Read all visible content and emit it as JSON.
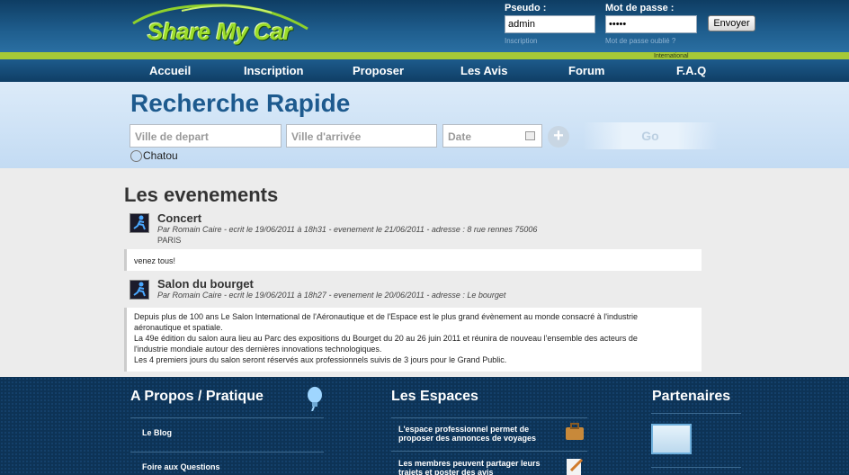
{
  "header": {
    "logo_text": "Share My Car",
    "pseudo_label": "Pseudo :",
    "pseudo_value": "admin",
    "password_label": "Mot de passe :",
    "password_value": "•••••",
    "send_label": "Envoyer",
    "register_link": "Inscription",
    "forgot_link": "Mot de passe oublié ?",
    "international": "International"
  },
  "nav": [
    "Accueil",
    "Inscription",
    "Proposer",
    "Les Avis",
    "Forum",
    "F.A.Q"
  ],
  "search": {
    "title": "Recherche Rapide",
    "from_placeholder": "Ville de depart",
    "to_placeholder": "Ville d'arrivée",
    "date_placeholder": "Date",
    "go_label": "Go",
    "city": "Chatou"
  },
  "events": {
    "title": "Les evenements",
    "items": [
      {
        "title": "Concert",
        "meta": "Par Romain Caire - ecrit le 19/06/2011 à 18h31 - evenement le 21/06/2011 - adresse : 8 rue rennes 75006",
        "meta2": "PARIS",
        "body": [
          "venez tous!"
        ]
      },
      {
        "title": "Salon du bourget",
        "meta": "Par Romain Caire - ecrit le 19/06/2011 à 18h27 - evenement le 20/06/2011 - adresse : Le bourget",
        "meta2": "",
        "body": [
          "Depuis plus de 100 ans Le Salon International de l'Aéronautique et de l'Espace est le plus grand évènement au monde consacré à l'industrie",
          "aéronautique et spatiale.",
          "La 49e édition du salon aura lieu au Parc des expositions du Bourget du 20 au 26 juin 2011 et réunira de nouveau l'ensemble des acteurs de",
          "l'industrie mondiale autour des dernières innovations technologiques.",
          "Les 4 premiers jours du salon seront réservés aux professionnels suivis de 3 jours pour le Grand Public."
        ]
      }
    ]
  },
  "footer": {
    "about_title": "A Propos / Pratique",
    "about_links": [
      "Le Blog",
      "Foire aux Questions"
    ],
    "spaces_title": "Les Espaces",
    "spaces_items": [
      {
        "line1": "L'espace professionnel permet de",
        "line2": "proposer des annonces de voyages"
      },
      {
        "line1": "Les membres peuvent partager leurs",
        "line2": "trajets et poster des avis"
      }
    ],
    "partners_title": "Partenaires"
  },
  "colors": {
    "accent": "#1d5a8e",
    "stripe": "#a6c937",
    "footer": "#0d3356"
  }
}
